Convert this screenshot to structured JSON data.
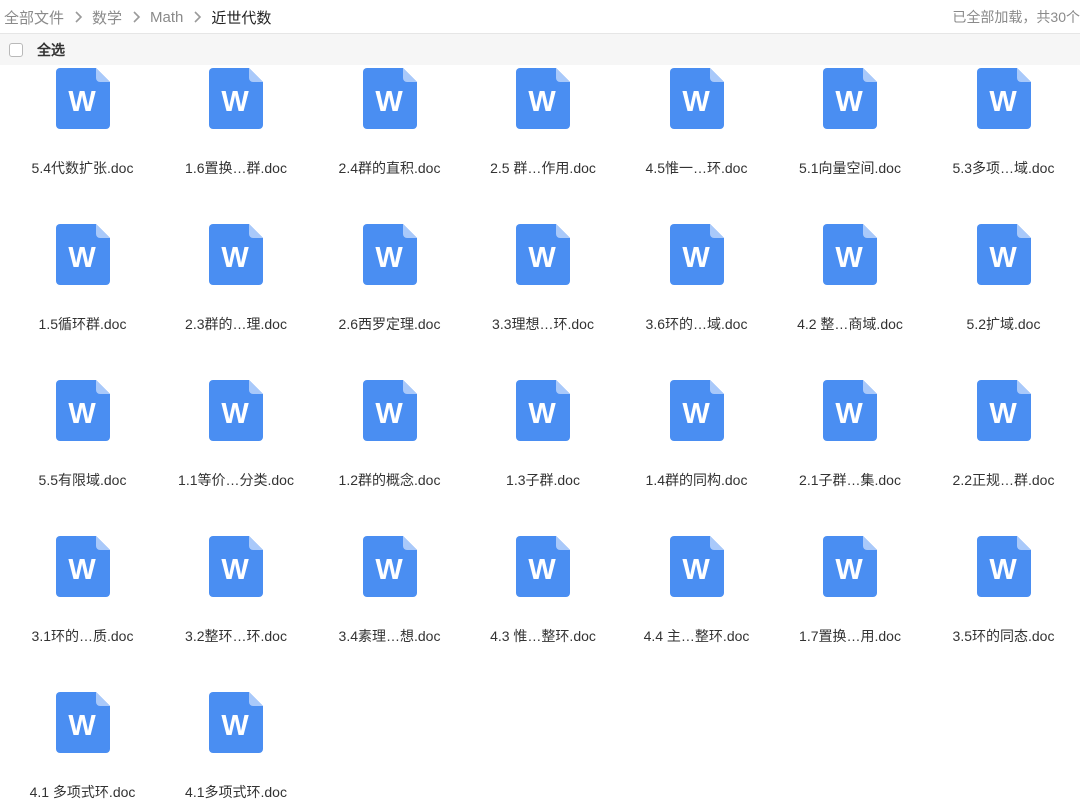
{
  "breadcrumb": {
    "items": [
      "全部文件",
      "数学",
      "Math"
    ],
    "current": "近世代数"
  },
  "status": "已全部加载，共30个",
  "selectbar": {
    "label": "全选"
  },
  "colors": {
    "doc_icon": "#4a8ef2",
    "doc_fold": "#a9c9fa"
  },
  "files": [
    "5.4代数扩张.doc",
    "1.6置换…群.doc",
    "2.4群的直积.doc",
    "2.5 群…作用.doc",
    "4.5惟一…环.doc",
    "5.1向量空间.doc",
    "5.3多项…域.doc",
    "1.5循环群.doc",
    "2.3群的…理.doc",
    "2.6西罗定理.doc",
    "3.3理想…环.doc",
    "3.6环的…域.doc",
    "4.2 整…商域.doc",
    "5.2扩域.doc",
    "5.5有限域.doc",
    "1.1等价…分类.doc",
    "1.2群的概念.doc",
    "1.3子群.doc",
    "1.4群的同构.doc",
    "2.1子群…集.doc",
    "2.2正规…群.doc",
    "3.1环的…质.doc",
    "3.2整环…环.doc",
    "3.4素理…想.doc",
    "4.3 惟…整环.doc",
    "4.4 主…整环.doc",
    "1.7置换…用.doc",
    "3.5环的同态.doc",
    "4.1  多项式环.doc",
    "4.1多项式环.doc"
  ]
}
